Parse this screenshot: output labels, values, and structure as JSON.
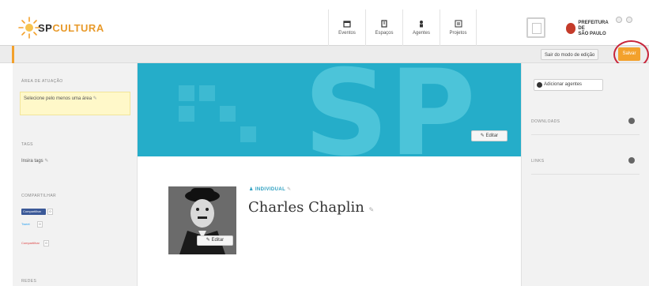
{
  "header": {
    "logo_prefix": "SP",
    "logo_suffix": "CULTURA",
    "nav": [
      {
        "label": "Eventos",
        "icon": "calendar-icon"
      },
      {
        "label": "Espaços",
        "icon": "building-icon"
      },
      {
        "label": "Agentes",
        "icon": "person-icon"
      },
      {
        "label": "Projetos",
        "icon": "list-icon"
      }
    ],
    "prefeitura_line1": "PREFEITURA DE",
    "prefeitura_line2": "SÃO PAULO"
  },
  "toolbar": {
    "exit_label": "Sair do modo de edição",
    "save_label": "Salvar",
    "accent_color": "#f3a12c",
    "highlight_color": "#c7243a"
  },
  "left": {
    "area_title": "ÁREA DE ATUAÇÃO",
    "area_prompt": "Selecione pelo menos uma área",
    "tags_title": "TAGS",
    "tags_prompt": "Insira tags",
    "share_title": "COMPARTILHAR",
    "share": {
      "facebook": "Compartilhar",
      "facebook_count": "0",
      "twitter": "Tweet",
      "twitter_count": "0",
      "google": "Compartilhar",
      "google_count": "0"
    },
    "bottom_title": "REDES"
  },
  "main": {
    "cover_color": "#25adc9",
    "cover_edit_label": "Editar",
    "avatar_edit_label": "Editar",
    "type_label": "INDIVIDUAL",
    "name": "Charles Chaplin"
  },
  "right": {
    "add_agents_label": "Adicionar agentes",
    "downloads_title": "DOWNLOADS",
    "links_title": "LINKS"
  }
}
